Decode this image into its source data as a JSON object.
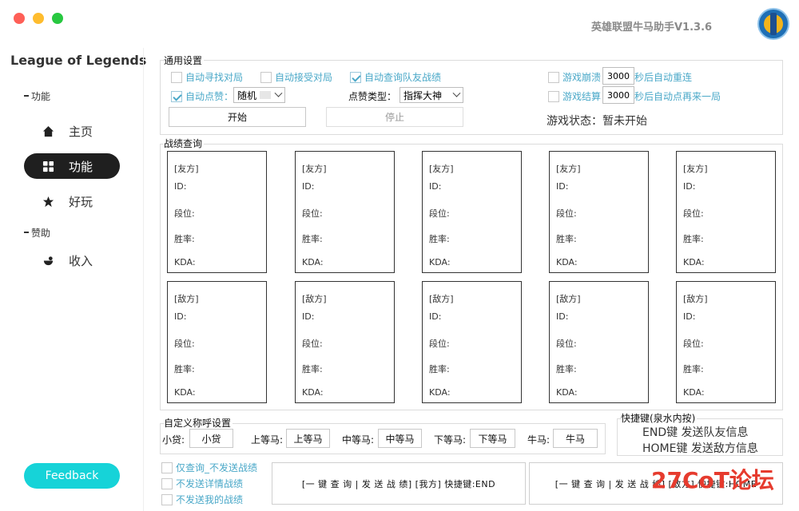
{
  "window": {
    "app_title": "英雄联盟牛马助手V1.3.6",
    "logo_icon": "league-logo-icon"
  },
  "sidebar": {
    "brand": "League of Legends",
    "group_feature": "功能",
    "group_sponsor": "赞助",
    "items": [
      {
        "label": "主页",
        "icon": "home-icon"
      },
      {
        "label": "功能",
        "icon": "grid-icon",
        "active": true
      },
      {
        "label": "好玩",
        "icon": "star-icon"
      },
      {
        "label": "收入",
        "icon": "coin-icon"
      }
    ],
    "feedback_label": "Feedback"
  },
  "general": {
    "title": "通用设置",
    "auto_find_match": "自动寻找对局",
    "auto_accept_match": "自动接受对局",
    "auto_query_team": "自动查询队友战绩",
    "auto_like": "自动点赞：",
    "like_mode_value": "随机",
    "like_type_label": "点赞类型：",
    "like_type_value": "指挥大神",
    "game_crash": "游戏崩溃",
    "crash_seconds": "3000",
    "crash_suffix": "秒后自动重连",
    "game_end": "游戏结算",
    "end_seconds": "3000",
    "end_suffix": "秒后自动点再来一局",
    "start_button": "开始",
    "stop_button": "停止",
    "status_text": "游戏状态：暂未开始"
  },
  "records": {
    "title": "战绩查询",
    "ally_tag": "[友方]",
    "enemy_tag": "[敌方]",
    "id_label": "ID:",
    "rank_label": "段位:",
    "winrate_label": "胜率:",
    "kda_label": "KDA:"
  },
  "nicknames": {
    "title": "自定义称呼设置",
    "fields": [
      {
        "label": "小贷:",
        "value": "小贷"
      },
      {
        "label": "上等马:",
        "value": "上等马"
      },
      {
        "label": "中等马:",
        "value": "中等马"
      },
      {
        "label": "下等马:",
        "value": "下等马"
      },
      {
        "label": "牛马:",
        "value": "牛马"
      }
    ]
  },
  "hotkeys": {
    "title": "快捷键(泉水内按)",
    "end_line": "END键 发送队友信息",
    "home_line": "HOME键 发送敌方信息"
  },
  "bottom": {
    "only_query": "仅查询_不发送战绩",
    "no_detail": "不发送详情战绩",
    "no_mine": "不发送我的战绩",
    "ally_button": "[一 键 查 询 | 发 送 战 绩] [我方] 快捷键:END",
    "enemy_button": "[一 键 查 询 | 发 送 战 绩] [敌方] 快捷键:HOME"
  },
  "watermark": "27CoT论坛"
}
